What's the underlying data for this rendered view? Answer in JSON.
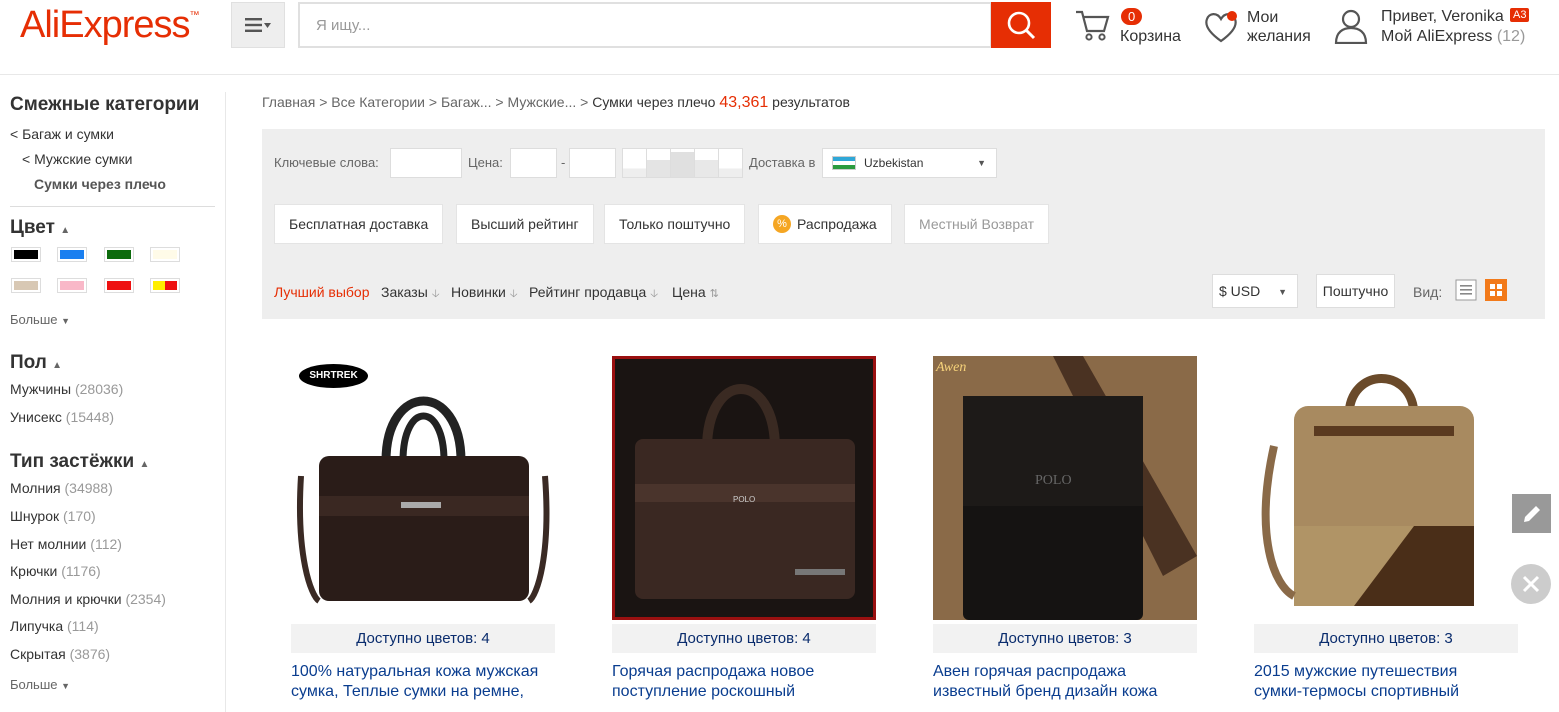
{
  "header": {
    "logo": "AliExpress",
    "logo_tm": "™",
    "search_placeholder": "Я ищу...",
    "cart_count": "0",
    "cart_label": "Корзина",
    "wish_label_1": "Мои",
    "wish_label_2": "желания",
    "greeting": "Привет, Veronika",
    "account_badge": "A3",
    "my_ali": "Мой AliExpress",
    "my_ali_count": "(12)"
  },
  "sidebar": {
    "related_title": "Смежные категории",
    "related": [
      "< Багаж и сумки",
      "< Мужские сумки",
      "Сумки через плечо"
    ],
    "color_title": "Цвет",
    "colors": [
      "#000000",
      "#1a7ff0",
      "#0c6b0c",
      "#fffbe8",
      "#d8c8b4",
      "#f9b8c8",
      "#ee1111",
      "#ffee00"
    ],
    "more": "Больше",
    "gender_title": "Пол",
    "gender": [
      {
        "label": "Мужчины",
        "count": "(28036)"
      },
      {
        "label": "Унисекс",
        "count": "(15448)"
      }
    ],
    "closure_title": "Тип застёжки",
    "closure": [
      {
        "label": "Молния",
        "count": "(34988)"
      },
      {
        "label": "Шнурок",
        "count": "(170)"
      },
      {
        "label": "Нет молнии",
        "count": "(112)"
      },
      {
        "label": "Крючки",
        "count": "(1176)"
      },
      {
        "label": "Молния и крючки",
        "count": "(2354)"
      },
      {
        "label": "Липучка",
        "count": "(114)"
      },
      {
        "label": "Скрытая",
        "count": "(3876)"
      }
    ]
  },
  "breadcrumb": {
    "home": "Главная",
    "sep": ">",
    "all": "Все Категории",
    "luggage": "Багаж...",
    "mens": "Мужские...",
    "current": "Сумки через плечо",
    "count": "43,361",
    "results": "результатов"
  },
  "filters": {
    "keywords": "Ключевые слова:",
    "price": "Цена:",
    "dash": "-",
    "ship_to": "Доставка в",
    "country": "Uzbekistan",
    "buttons": [
      "Бесплатная доставка",
      "Высший рейтинг",
      "Только поштучно",
      "Распродажа",
      "Местный Возврат"
    ],
    "sale_icon": "%"
  },
  "sort": {
    "best": "Лучший выбор",
    "orders": "Заказы",
    "new": "Новинки",
    "rating": "Рейтинг продавца",
    "price": "Цена",
    "currency": "$ USD",
    "unit": "Поштучно",
    "view": "Вид:"
  },
  "products": [
    {
      "brand": "SHRTREK",
      "avail": "Доступно цветов: 4",
      "title_1": "100% натуральная кожа мужская",
      "title_2": "сумка, Теплые сумки на ремне,"
    },
    {
      "brand": "POLO",
      "avail": "Доступно цветов: 4",
      "title_1": "Горячая распродажа новое",
      "title_2": "поступление роскошный"
    },
    {
      "brand": "Awen",
      "avail": "Доступно цветов: 3",
      "title_1": "Авен горячая распродажа",
      "title_2": "известный бренд дизайн кожа"
    },
    {
      "brand": "",
      "avail": "Доступно цветов: 3",
      "title_1": "2015 мужские путешествия",
      "title_2": "сумки-термосы спортивный"
    }
  ],
  "colors": {
    "accent": "#e62e04",
    "link": "#0a3d8f",
    "panel": "#eeeeee"
  }
}
